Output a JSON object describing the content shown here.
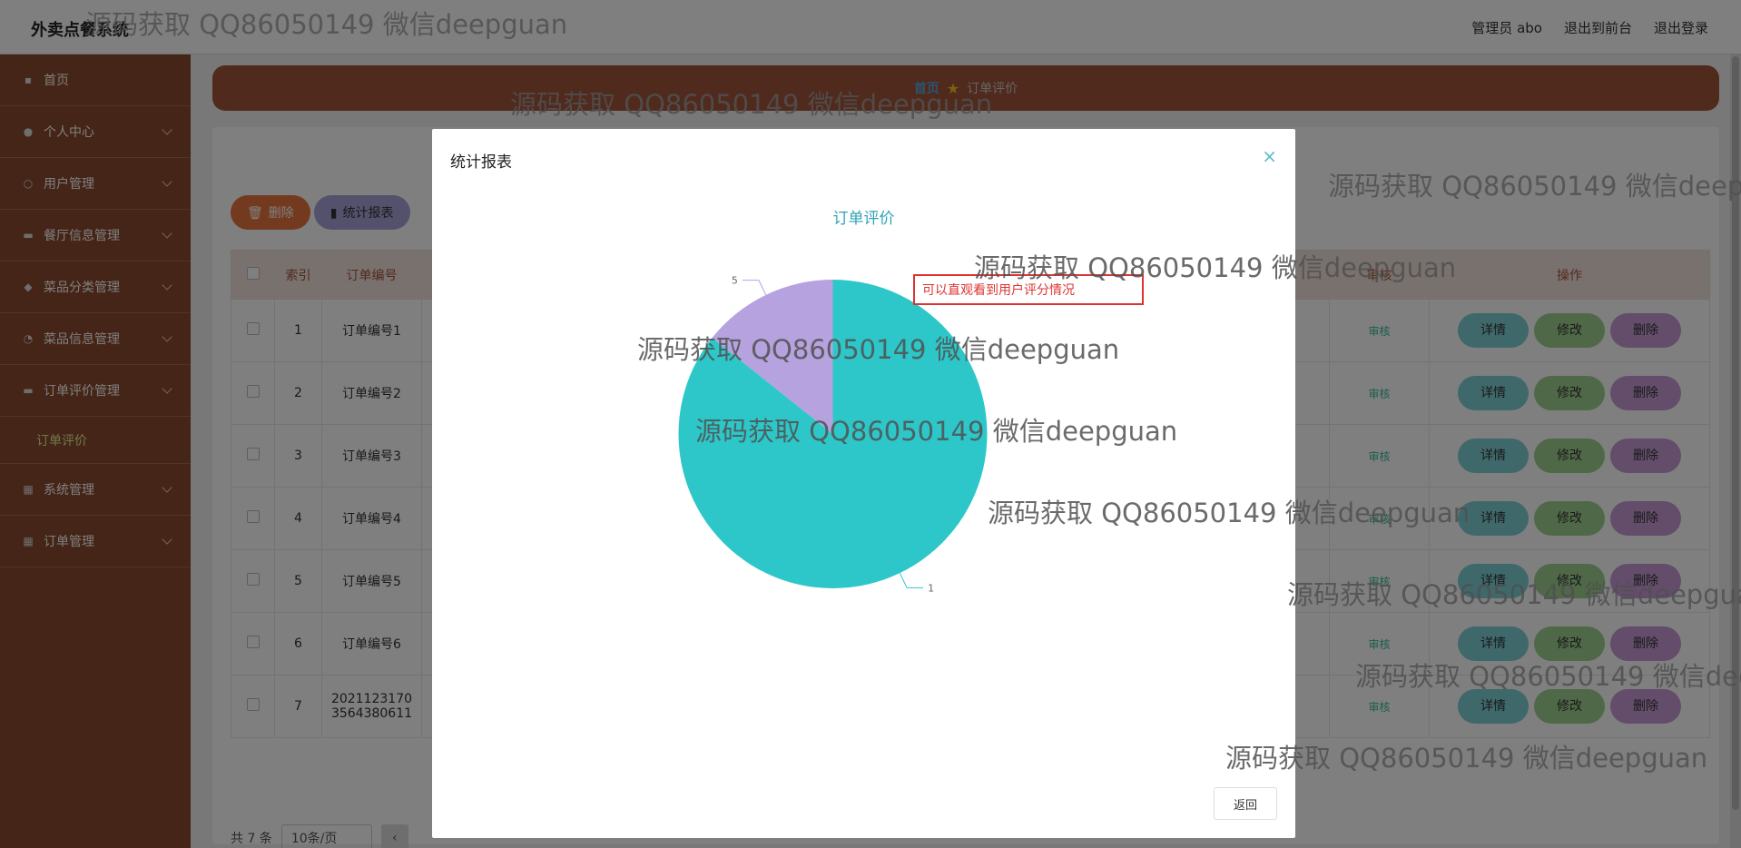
{
  "header": {
    "app_title": "外卖点餐系统",
    "user_label": "管理员 abo",
    "exit_front": "退出到前台",
    "logout": "退出登录"
  },
  "sidebar": {
    "items": [
      {
        "label": "首页",
        "icon": "home-icon"
      },
      {
        "label": "个人中心",
        "icon": "user-icon"
      },
      {
        "label": "用户管理",
        "icon": "users-icon"
      },
      {
        "label": "餐厅信息管理",
        "icon": "restaurant-icon"
      },
      {
        "label": "菜品分类管理",
        "icon": "category-icon"
      },
      {
        "label": "菜品信息管理",
        "icon": "dish-icon"
      },
      {
        "label": "订单评价管理",
        "icon": "review-icon"
      }
    ],
    "sub_item": "订单评价",
    "items_after": [
      {
        "label": "系统管理",
        "icon": "system-icon"
      },
      {
        "label": "订单管理",
        "icon": "order-icon"
      }
    ]
  },
  "breadcrumb": {
    "home": "首页",
    "current": "订单评价"
  },
  "toolbar": {
    "delete_label": "删除",
    "stats_label": "统计报表"
  },
  "table": {
    "headers": [
      "索引",
      "订单编号",
      "审核",
      "操作"
    ],
    "rows": [
      {
        "index": "1",
        "order_no": "订单编号1"
      },
      {
        "index": "2",
        "order_no": "订单编号2"
      },
      {
        "index": "3",
        "order_no": "订单编号3"
      },
      {
        "index": "4",
        "order_no": "订单编号4"
      },
      {
        "index": "5",
        "order_no": "订单编号5"
      },
      {
        "index": "6",
        "order_no": "订单编号6"
      },
      {
        "index": "7",
        "order_no": "20211231703564380611"
      }
    ],
    "audit_label": "审核",
    "detail_label": "详情",
    "edit_label": "修改",
    "del_label": "删除"
  },
  "pager": {
    "total": "共 7 条",
    "page_size": "10条/页"
  },
  "modal": {
    "title": "统计报表",
    "close": "×",
    "chart_title": "订单评价",
    "note": "可以直观看到用户评分情况",
    "back_label": "返回"
  },
  "chart_data": {
    "type": "pie",
    "title": "订单评价",
    "categories": [
      "1",
      "5"
    ],
    "values": [
      6,
      1
    ],
    "colors": [
      "#2ec7c9",
      "#b6a2de"
    ]
  },
  "watermark": "源码获取 QQ86050149 微信deepguan"
}
